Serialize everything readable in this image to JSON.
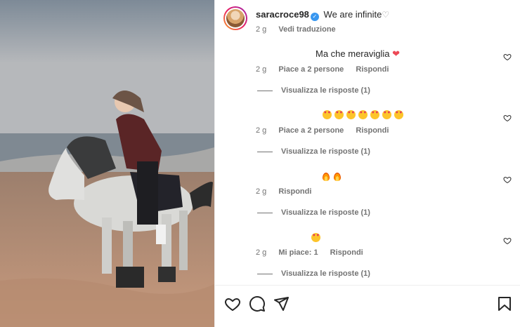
{
  "post": {
    "username": "saracroce98",
    "caption": "We are infinite",
    "time": "2 g",
    "translate_label": "Vedi traduzione"
  },
  "comments": [
    {
      "text": "Ma che meraviglia",
      "emoji": "red-heart",
      "time": "2 g",
      "likes_label": "Piace a 2 persone",
      "reply_label": "Rispondi",
      "view_replies": "Visualizza le risposte (1)"
    },
    {
      "text": "",
      "emoji": "heart-eyes x7",
      "time": "2 g",
      "likes_label": "Piace a 2 persone",
      "reply_label": "Rispondi",
      "view_replies": "Visualizza le risposte (1)"
    },
    {
      "text": "",
      "emoji": "fire x2",
      "time": "2 g",
      "reply_label": "Rispondi",
      "view_replies": "Visualizza le risposte (1)"
    },
    {
      "text": "",
      "emoji": "heart-eyes x1",
      "time": "2 g",
      "likes_label": "Mi piace: 1",
      "reply_label": "Rispondi",
      "view_replies": "Visualizza le risposte (1)"
    }
  ],
  "icons": {
    "like": "heart-outline-icon",
    "comment": "comment-bubble-icon",
    "share": "paper-plane-icon",
    "save": "bookmark-icon"
  },
  "colors": {
    "verified": "#3897f0",
    "meta_text": "#737373",
    "text": "#262626",
    "heart": "#ed4956"
  }
}
